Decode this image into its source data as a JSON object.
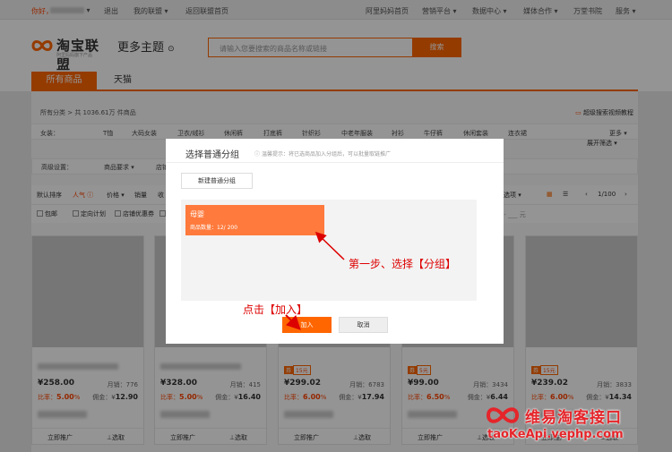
{
  "topbar": {
    "greeting": "你好，",
    "logout": "退出",
    "my_alliance": "我的联盟",
    "back_home": "返回联盟首页",
    "right_links": [
      "阿里妈妈首页",
      "营销平台",
      "数据中心",
      "媒体合作",
      "万堂书院",
      "服务"
    ]
  },
  "header": {
    "logo_text": "淘宝联盟",
    "logo_sub": "阿里妈妈旗下产品",
    "more_themes": "更多主题",
    "search_placeholder": "请输入您要搜索的商品名称或链接",
    "search_button": "搜索"
  },
  "tabs": {
    "all": "所有商品",
    "tmall": "天猫"
  },
  "category_bar": {
    "crumb": "所有分类 > 共 1036.61万 件商品",
    "video_link": "超级搜索视频教程",
    "label": "女装：",
    "items": [
      "T恤",
      "大码女装",
      "卫衣/绒衫",
      "休闲裤",
      "打底裤",
      "针织衫",
      "中老年服装",
      "衬衫",
      "牛仔裤",
      "休闲套装",
      "连衣裙"
    ],
    "more": "更多",
    "expand": "展开筛选"
  },
  "advanced": {
    "label": "高级设置：",
    "item1": "商品要求",
    "item2": "店铺"
  },
  "sort": {
    "default": "默认排序",
    "popularity": "人气",
    "price": "价格",
    "sales": "销量",
    "income": "收",
    "view_mode": "选项",
    "page": "1/100"
  },
  "checks": [
    "包邮",
    "定向计划",
    "店铺优惠券",
    "月"
  ],
  "products": [
    {
      "price": "258.00",
      "sales": "776",
      "rate": "5.00",
      "commission": "12.90",
      "coupon": ""
    },
    {
      "price": "328.00",
      "sales": "415",
      "rate": "5.00",
      "commission": "16.40",
      "coupon": ""
    },
    {
      "price": "299.02",
      "sales": "6783",
      "rate": "6.00",
      "commission": "17.94",
      "coupon": "15元"
    },
    {
      "price": "99.00",
      "sales": "3434",
      "rate": "6.50",
      "commission": "6.44",
      "coupon": "5元"
    },
    {
      "price": "239.02",
      "sales": "3833",
      "rate": "6.00",
      "commission": "14.34",
      "coupon": "15元"
    }
  ],
  "card_text": {
    "sales_label": "月销：",
    "rate_label": "比率：",
    "commission_label": "佣金：",
    "promote": "立即推广",
    "pick": "选取",
    "coupon_tag": "券"
  },
  "dialog": {
    "title": "选择普通分组",
    "hint": "温馨提示：将已选商品加入分组后，可以批量取链推广",
    "new_group": "新建普通分组",
    "group_name": "母婴",
    "group_count": "商品数量：12/ 200",
    "add": "加入",
    "cancel": "取消"
  },
  "annotations": {
    "step1": "第一步、选择【分组】",
    "click_add": "点击【加入】"
  },
  "watermark": {
    "title": "维易淘客接口",
    "url": "taoKeApi.vephp.com"
  }
}
